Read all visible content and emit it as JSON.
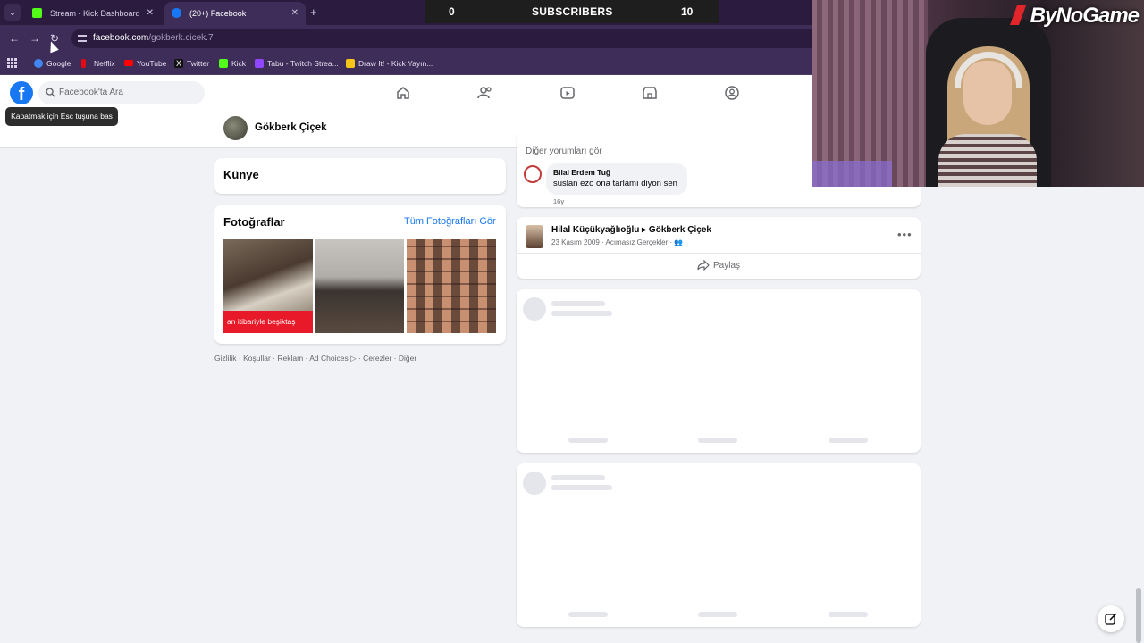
{
  "browser": {
    "tabs": [
      {
        "label": "Stream - Kick Dashboard",
        "favicon": "kick-icon",
        "active": false
      },
      {
        "label": "(20+) Facebook",
        "favicon": "facebook-icon",
        "active": true
      }
    ],
    "url_domain": "facebook.com",
    "url_path": "/gokberk.cicek.7",
    "bookmarks": [
      {
        "label": "Google",
        "icon": "google-icon",
        "color": "#4285f4"
      },
      {
        "label": "Netflix",
        "icon": "netflix-icon",
        "color": "#e50914"
      },
      {
        "label": "YouTube",
        "icon": "youtube-icon",
        "color": "#ff0000"
      },
      {
        "label": "Twitter",
        "icon": "twitter-icon",
        "color": "#111111"
      },
      {
        "label": "Kick",
        "icon": "kick-icon",
        "color": "#53fc18"
      },
      {
        "label": "Tabu - Twitch Strea...",
        "icon": "tabu-icon",
        "color": "#9146ff"
      },
      {
        "label": "Draw It! - Kick Yayın...",
        "icon": "drawit-icon",
        "color": "#f5c518"
      }
    ]
  },
  "stream_overlay": {
    "left_count": "0",
    "label": "SUBSCRIBERS",
    "right_count": "10",
    "brand": "ByNoGame"
  },
  "facebook": {
    "search_placeholder": "Facebook'ta Ara",
    "tooltip": "Kapatmak için Esc tuşuna bas",
    "profile_name": "Gökberk Çiçek",
    "kunye_title": "Künye",
    "photos_title": "Fotoğraflar",
    "photos_link": "Tüm Fotoğrafları Gör",
    "photo_caption": "an itibariyle beşiktaş",
    "footer": "Gizlilik · Koşullar · Reklam · Ad Choices ▷ · Çerezler · Diğer",
    "more_comments": "Diğer yorumları gör",
    "comment": {
      "author": "Bilal Erdem Tuğ",
      "text": "suslan ezo ona tarlamı diyon sen",
      "time": "16y"
    },
    "post": {
      "author": "Hilal Küçükyağlıoğlu ▸ Gökberk Çiçek",
      "meta": "23 Kasım 2009 · Acımasız Gerçekler · 👥",
      "share": "Paylaş"
    },
    "brand_color": "#1877f2"
  }
}
